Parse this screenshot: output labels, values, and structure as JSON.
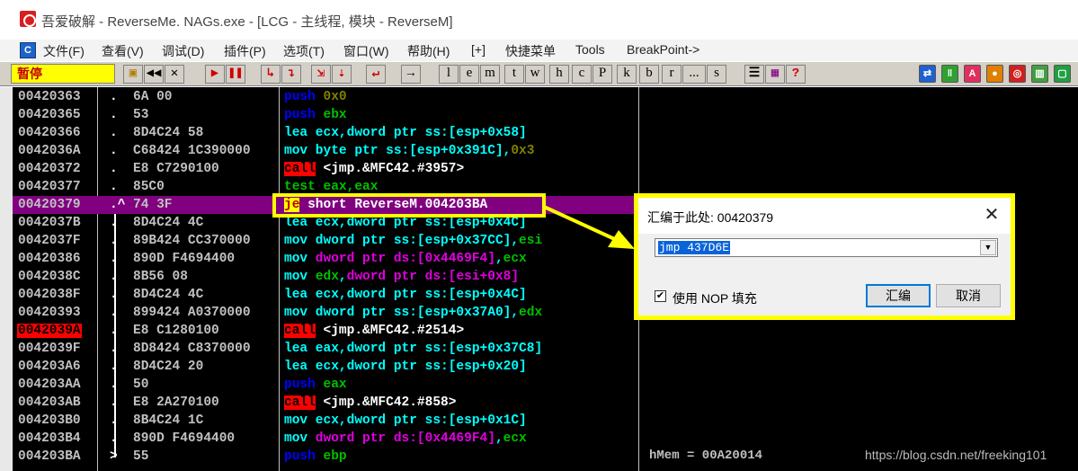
{
  "window": {
    "title": "吾爱破解 - ReverseMe. NAGs.exe - [LCG -  主线程, 模块 - ReverseM]"
  },
  "menu": [
    "文件(F)",
    "查看(V)",
    "调试(D)",
    "插件(P)",
    "选项(T)",
    "窗口(W)",
    "帮助(H)",
    "[+]",
    "快捷菜单",
    "Tools",
    "BreakPoint->"
  ],
  "toolbar": {
    "status": "暂停",
    "letters": [
      "l",
      "e",
      "m",
      "t",
      "w",
      "h",
      "c",
      "P",
      "k",
      "b",
      "r",
      "...",
      "s"
    ],
    "icon_names": [
      "open-icon",
      "rewind-icon",
      "close-icon",
      "run-icon",
      "pause-icon",
      "step-into-icon",
      "step-over-icon",
      "trace-into-icon",
      "trace-over-icon",
      "execute-till-return-icon",
      "goto-icon"
    ]
  },
  "disasm": {
    "rows": [
      {
        "addr": "00420363",
        "mark": ".",
        "hex": "6A 00",
        "asm": [
          [
            "push",
            "push"
          ],
          [
            " ",
            "white"
          ],
          [
            "0x0",
            "num"
          ]
        ]
      },
      {
        "addr": "00420365",
        "mark": ".",
        "hex": "53",
        "asm": [
          [
            "push",
            "push"
          ],
          [
            " ",
            "white"
          ],
          [
            "ebx",
            "reg"
          ]
        ]
      },
      {
        "addr": "00420366",
        "mark": ".",
        "hex": "8D4C24 58",
        "asm": [
          [
            "lea ecx,dword ptr ss:[esp+0x58]",
            "mem"
          ]
        ]
      },
      {
        "addr": "0042036A",
        "mark": ".",
        "hex": "C68424 1C390000",
        "asm": [
          [
            "mov byte ptr ss:[esp+0x391C],",
            "mem"
          ],
          [
            "0x3",
            "num"
          ]
        ]
      },
      {
        "addr": "00420372",
        "mark": ".",
        "hex": "E8 C7290100",
        "asm": [
          [
            "call",
            "call"
          ],
          [
            " <jmp.&MFC42.#3957>",
            "white"
          ]
        ]
      },
      {
        "addr": "00420377",
        "mark": ".",
        "hex": "85C0",
        "asm": [
          [
            "test eax,eax",
            "reg"
          ]
        ]
      },
      {
        "addr": "00420379",
        "mark": ".^",
        "hex": "74 3F",
        "asm": [
          [
            "je",
            "je"
          ],
          [
            " short ReverseM.004203BA",
            "white"
          ]
        ],
        "highlight": true
      },
      {
        "addr": "0042037B",
        "mark": ".",
        "hex": "8D4C24 4C",
        "asm": [
          [
            "lea ecx,dword ptr ss:[esp+0x4C]",
            "mem"
          ]
        ]
      },
      {
        "addr": "0042037F",
        "mark": ".",
        "hex": "89B424 CC370000",
        "asm": [
          [
            "mov dword ptr ss:[esp+0x37CC],",
            "mem"
          ],
          [
            "esi",
            "reg"
          ]
        ]
      },
      {
        "addr": "00420386",
        "mark": ".",
        "hex": "890D F4694400",
        "asm": [
          [
            "mov",
            "mem"
          ],
          [
            " dword ptr ds:[0x4469F4]",
            "memi"
          ],
          [
            ",",
            "mem"
          ],
          [
            "ecx",
            "reg"
          ]
        ]
      },
      {
        "addr": "0042038C",
        "mark": ".",
        "hex": "8B56 08",
        "asm": [
          [
            "mov ",
            "mem"
          ],
          [
            "edx",
            "reg"
          ],
          [
            ",",
            "mem"
          ],
          [
            "dword ptr ds:[esi+0x8]",
            "memi"
          ]
        ]
      },
      {
        "addr": "0042038F",
        "mark": ".",
        "hex": "8D4C24 4C",
        "asm": [
          [
            "lea ecx,dword ptr ss:[esp+0x4C]",
            "mem"
          ]
        ]
      },
      {
        "addr": "00420393",
        "mark": ".",
        "hex": "899424 A0370000",
        "asm": [
          [
            "mov dword ptr ss:[esp+0x37A0],",
            "mem"
          ],
          [
            "edx",
            "reg"
          ]
        ]
      },
      {
        "addr": "0042039A",
        "mark": ".",
        "hex": "E8 C1280100",
        "asm": [
          [
            "call",
            "call"
          ],
          [
            " <jmp.&MFC42.#2514>",
            "white"
          ]
        ],
        "bp": true
      },
      {
        "addr": "0042039F",
        "mark": ".",
        "hex": "8D8424 C8370000",
        "asm": [
          [
            "lea eax,dword ptr ss:[esp+0x37C8]",
            "mem"
          ]
        ]
      },
      {
        "addr": "004203A6",
        "mark": ".",
        "hex": "8D4C24 20",
        "asm": [
          [
            "lea ecx,dword ptr ss:[esp+0x20]",
            "mem"
          ]
        ]
      },
      {
        "addr": "004203AA",
        "mark": ".",
        "hex": "50",
        "asm": [
          [
            "push",
            "push"
          ],
          [
            " ",
            "white"
          ],
          [
            "eax",
            "reg"
          ]
        ]
      },
      {
        "addr": "004203AB",
        "mark": ".",
        "hex": "E8 2A270100",
        "asm": [
          [
            "call",
            "call"
          ],
          [
            " <jmp.&MFC42.#858>",
            "white"
          ]
        ]
      },
      {
        "addr": "004203B0",
        "mark": ".",
        "hex": "8B4C24 1C",
        "asm": [
          [
            "mov ecx,dword ptr ss:[esp+0x1C]",
            "mem"
          ]
        ]
      },
      {
        "addr": "004203B4",
        "mark": ".",
        "hex": "890D F4694400",
        "asm": [
          [
            "mov",
            "mem"
          ],
          [
            " dword ptr ds:[0x4469F4]",
            "memi"
          ],
          [
            ",",
            "mem"
          ],
          [
            "ecx",
            "reg"
          ]
        ]
      },
      {
        "addr": "004203BA",
        "mark": ">",
        "hex": "55",
        "asm": [
          [
            "push",
            "push"
          ],
          [
            " ",
            "white"
          ],
          [
            "ebp",
            "reg"
          ]
        ]
      }
    ],
    "info": "hMem = 00A20014",
    "watermark": "https://blog.csdn.net/freeking101"
  },
  "dialog": {
    "title": "汇编于此处: 00420379",
    "input_value": "jmp 437D6E",
    "nop_label": "使用 NOP 填充",
    "nop_checked": true,
    "assemble_label": "汇编",
    "cancel_label": "取消"
  },
  "colors": {
    "highlight_row": "#800080",
    "annotation": "#ffff00"
  }
}
